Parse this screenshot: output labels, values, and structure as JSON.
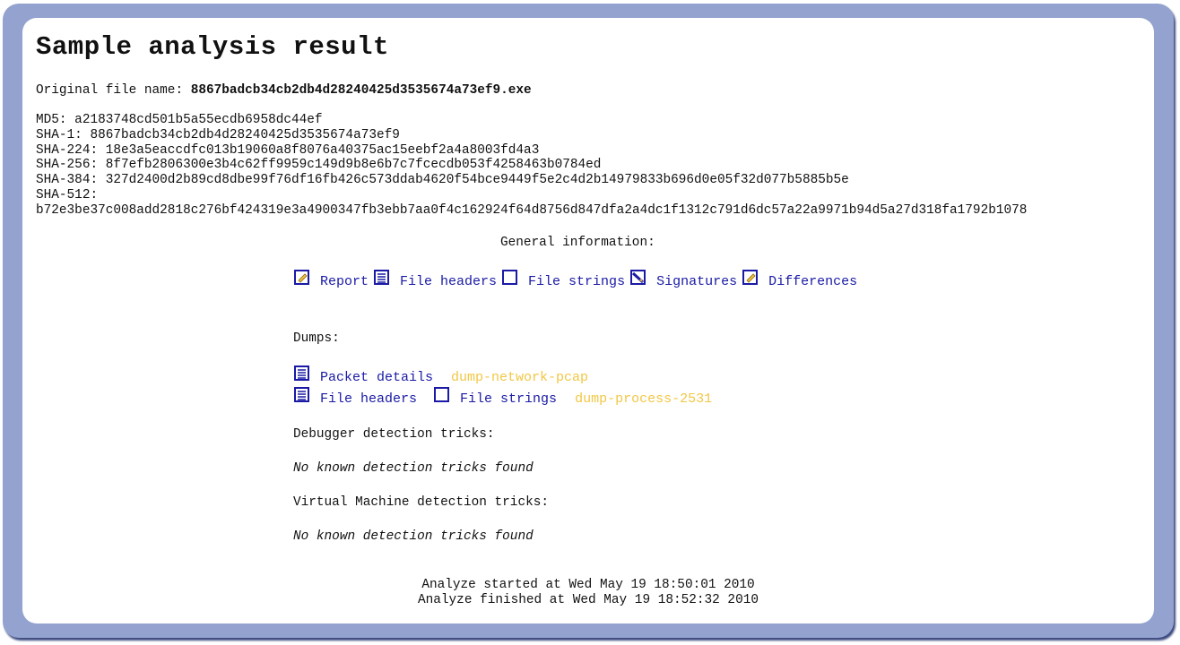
{
  "page": {
    "title": "Sample analysis result",
    "original_file_label": "Original file name: ",
    "original_file_value": "8867badcb34cb2db4d28240425d3535674a73ef9.exe"
  },
  "hashes": {
    "md5": "MD5: a2183748cd501b5a55ecdb6958dc44ef",
    "sha1": "SHA-1: 8867badcb34cb2db4d28240425d3535674a73ef9",
    "sha224": "SHA-224: 18e3a5eaccdfc013b19060a8f8076a40375ac15eebf2a4a8003fd4a3",
    "sha256": "SHA-256: 8f7efb2806300e3b4c62ff9959c149d9b8e6b7c7fcecdb053f4258463b0784ed",
    "sha384": "SHA-384: 327d2400d2b89cd8dbe99f76df16fb426c573ddab4620f54bce9449f5e2c4d2b14979833b696d0e05f32d077b5885b5e",
    "sha512_label": "SHA-512:",
    "sha512_value": "b72e3be37c008add2818c276bf424319e3a4900347fb3ebb7aa0f4c162924f64d8756d847dfa2a4dc1f1312c791d6dc57a22a9971b94d5a27d318fa1792b1078"
  },
  "general": {
    "heading": "General information:",
    "links": {
      "report": "Report",
      "file_headers": "File headers",
      "file_strings": "File strings",
      "signatures": "Signatures",
      "differences": "Differences"
    }
  },
  "dumps": {
    "heading": "Dumps:",
    "network": {
      "packet_details": "Packet details",
      "name": "dump-network-pcap"
    },
    "process": {
      "file_headers": "File headers",
      "file_strings": "File strings",
      "name": "dump-process-2531"
    }
  },
  "debugger": {
    "heading": "Debugger detection tricks:",
    "result": "No known detection tricks found"
  },
  "vm": {
    "heading": "Virtual Machine detection tricks:",
    "result": "No known detection tricks found"
  },
  "footer": {
    "started": "Analyze started at Wed May 19 18:50:01 2010",
    "finished": "Analyze finished at Wed May 19 18:52:32 2010"
  },
  "icons": {
    "report": "edit-document-icon",
    "file_headers": "lined-document-icon",
    "file_strings": "blank-document-icon",
    "signatures": "signed-document-icon",
    "differences": "edit-document-icon"
  },
  "colors": {
    "frame": "#93a2ce",
    "link": "#1a1aa6",
    "dump_name": "#f2c744"
  }
}
